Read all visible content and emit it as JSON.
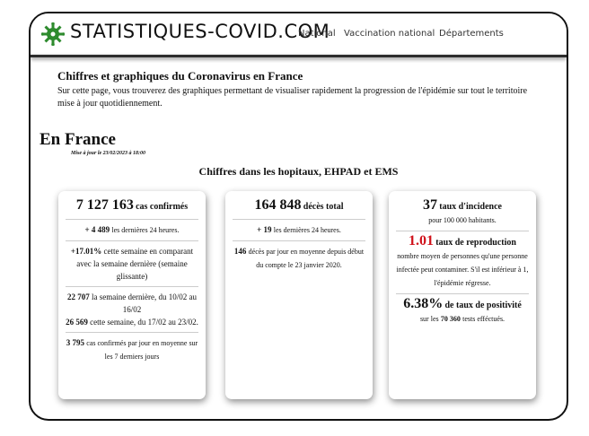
{
  "header": {
    "brand": "STATISTIQUES-COVID.COM",
    "nav": [
      "National",
      "Vaccination national",
      "Départements"
    ]
  },
  "intro": {
    "title": "Chiffres et graphiques du Coronavirus en France",
    "text": "Sur cette page, vous trouverez des graphiques permettant de visualiser rapidement la progression de l'épidémie sur tout le territoire mise à jour quotidiennement."
  },
  "section": {
    "title": "En France",
    "update": "Mise à jour le 23/02/2023 à 18:00",
    "subtitle": "Chiffres dans les hopitaux, EHPAD et EMS"
  },
  "cards": {
    "cases": {
      "value": "7 127 163",
      "label": "cas confirmés",
      "day_value": "+ 4 489",
      "day_text": "les dernières 24 heures.",
      "week_pct": "+17.01%",
      "week_text": "cette semaine en comparant avec la semaine dernière (semaine glissante)",
      "last_week_value": "22 707",
      "last_week_text": "la semaine dernière, du 10/02 au 16/02",
      "this_week_value": "26 569",
      "this_week_text": "cette semaine, du 17/02 au 23/02.",
      "avg_value": "3 795",
      "avg_text": "cas confirmés par jour en moyenne sur les 7 derniers jours"
    },
    "deaths": {
      "value": "164 848",
      "label": "décès total",
      "day_value": "+ 19",
      "day_text": "les dernières 24 heures.",
      "avg_value": "146",
      "avg_text": "décès par jour en moyenne depuis début du compte le 23 janvier 2020."
    },
    "rates": {
      "incidence_value": "37",
      "incidence_label": "taux d'incidence",
      "incidence_text": "pour 100 000 habitants.",
      "repro_value": "1.01",
      "repro_label": "taux de reproduction",
      "repro_text": "nombre moyen de personnes qu'une personne infectée peut contaminer. S'il est inférieur à 1, l'épidémie régresse.",
      "positivity_value": "6.38%",
      "positivity_label": "de taux de positivité",
      "tests_prefix": "sur les",
      "tests_value": "70 360",
      "tests_suffix": "tests efféctués."
    }
  },
  "colors": {
    "logo": "#2e8b2e",
    "accent_red": "#d0121b"
  }
}
